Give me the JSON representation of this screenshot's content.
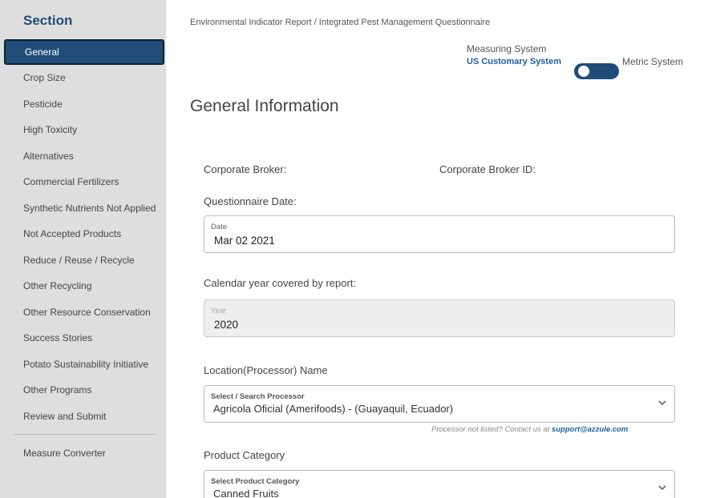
{
  "sidebar": {
    "title": "Section",
    "items": [
      {
        "label": "General",
        "active": true
      },
      {
        "label": "Crop Size"
      },
      {
        "label": "Pesticide"
      },
      {
        "label": "High Toxicity"
      },
      {
        "label": "Alternatives"
      },
      {
        "label": "Commercial Fertilizers"
      },
      {
        "label": "Synthetic Nutrients Not Applied"
      },
      {
        "label": "Not Accepted Products"
      },
      {
        "label": "Reduce / Reuse / Recycle"
      },
      {
        "label": "Other Recycling"
      },
      {
        "label": "Other Resource Conservation"
      },
      {
        "label": "Success Stories"
      },
      {
        "label": "Potato Sustainability Initiative"
      },
      {
        "label": "Other Programs"
      },
      {
        "label": "Review and Submit"
      }
    ],
    "measure_converter": "Measure Converter"
  },
  "breadcrumb": "Environmental Indicator Report / Integrated Pest Management Questionnaire",
  "measuring_system": {
    "label": "Measuring System",
    "us": "US Customary System",
    "metric": "Metric System"
  },
  "page_title": "General Information",
  "form": {
    "corporate_broker": "Corporate Broker:",
    "corporate_broker_id": "Corporate Broker ID:",
    "questionnaire_date_label": "Questionnaire Date:",
    "date_small": "Date",
    "date_value": "Mar 02 2021",
    "year_label": "Calendar year covered by report:",
    "year_small": "Year",
    "year_value": "2020",
    "location_label": "Location(Processor) Name",
    "processor_small": "Select / Search Processor",
    "processor_value": "Agricola Oficial (Amerifoods) - (Guayaquil, Ecuador)",
    "help_text": "Processor not listed? Contact us at",
    "help_email": "support@azzule.com",
    "product_category_label": "Product Category",
    "product_small": "Select Product Category",
    "product_value": "Canned Fruits"
  }
}
